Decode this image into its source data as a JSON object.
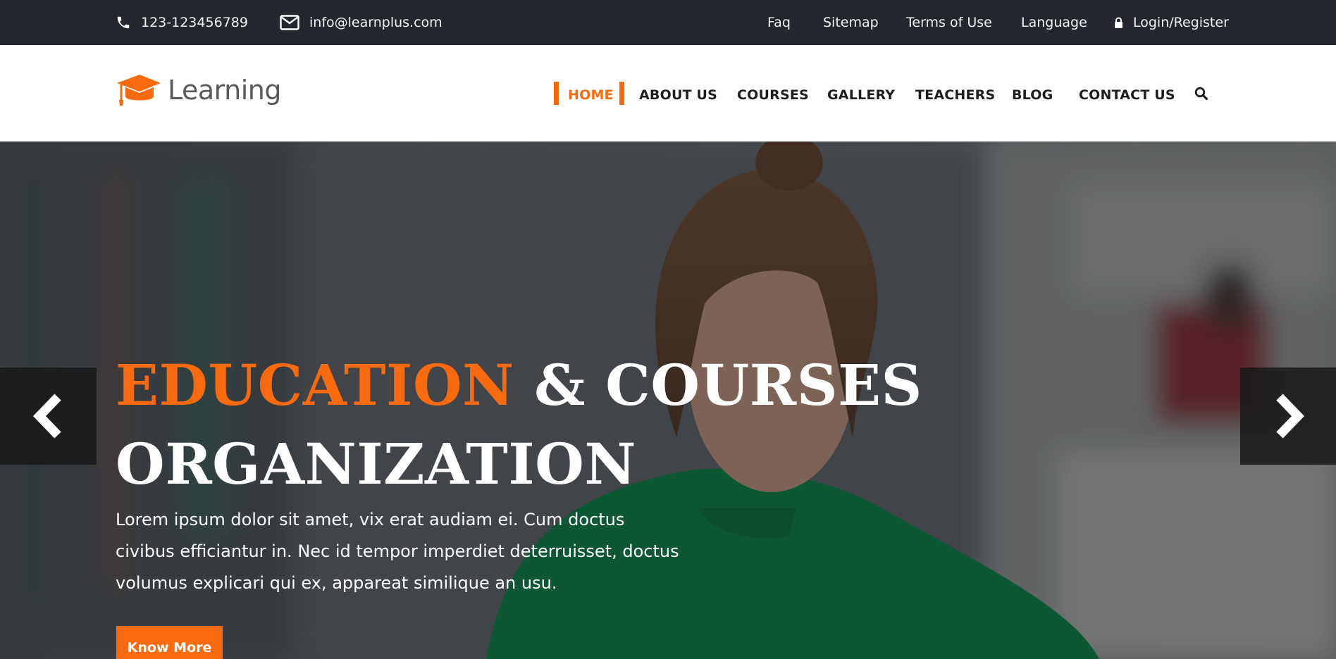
{
  "topbar": {
    "phone": "123-123456789",
    "email": "info@learnplus.com",
    "links": {
      "faq": "Faq",
      "sitemap": "Sitemap",
      "terms": "Terms of Use",
      "language": "Language",
      "login": "Login/Register"
    },
    "icons": [
      "phone-icon",
      "envelope-icon",
      "lock-icon"
    ]
  },
  "header": {
    "logo_text": "Learning",
    "logo_icon": "graduation-cap-icon",
    "nav": {
      "home": "HOME",
      "about": "ABOUT US",
      "courses": "COURSES",
      "gallery": "GALLERY",
      "teachers": "TEACHERS",
      "blog": "BLOG",
      "contact": "CONTACT US"
    },
    "active": "HOME",
    "search_icon": "search-icon"
  },
  "hero": {
    "title_accent": "EDUCATION",
    "title_rest": " & COURSES",
    "title_line2": "ORGANIZATION",
    "text": "Lorem ipsum dolor sit amet, vix erat audiam ei. Cum doctus civibus efficiantur in. Nec id tempor imperdiet deterruisset, doctus volumus explicari qui ex, appareat similique an usu.",
    "button": "Know More",
    "prev_icon": "chevron-left-icon",
    "next_icon": "chevron-right-icon"
  },
  "colors": {
    "accent": "#f96a0e",
    "topbar_bg": "#24272e",
    "header_bg": "#ffffff",
    "nav_text": "#1e1e1e"
  }
}
